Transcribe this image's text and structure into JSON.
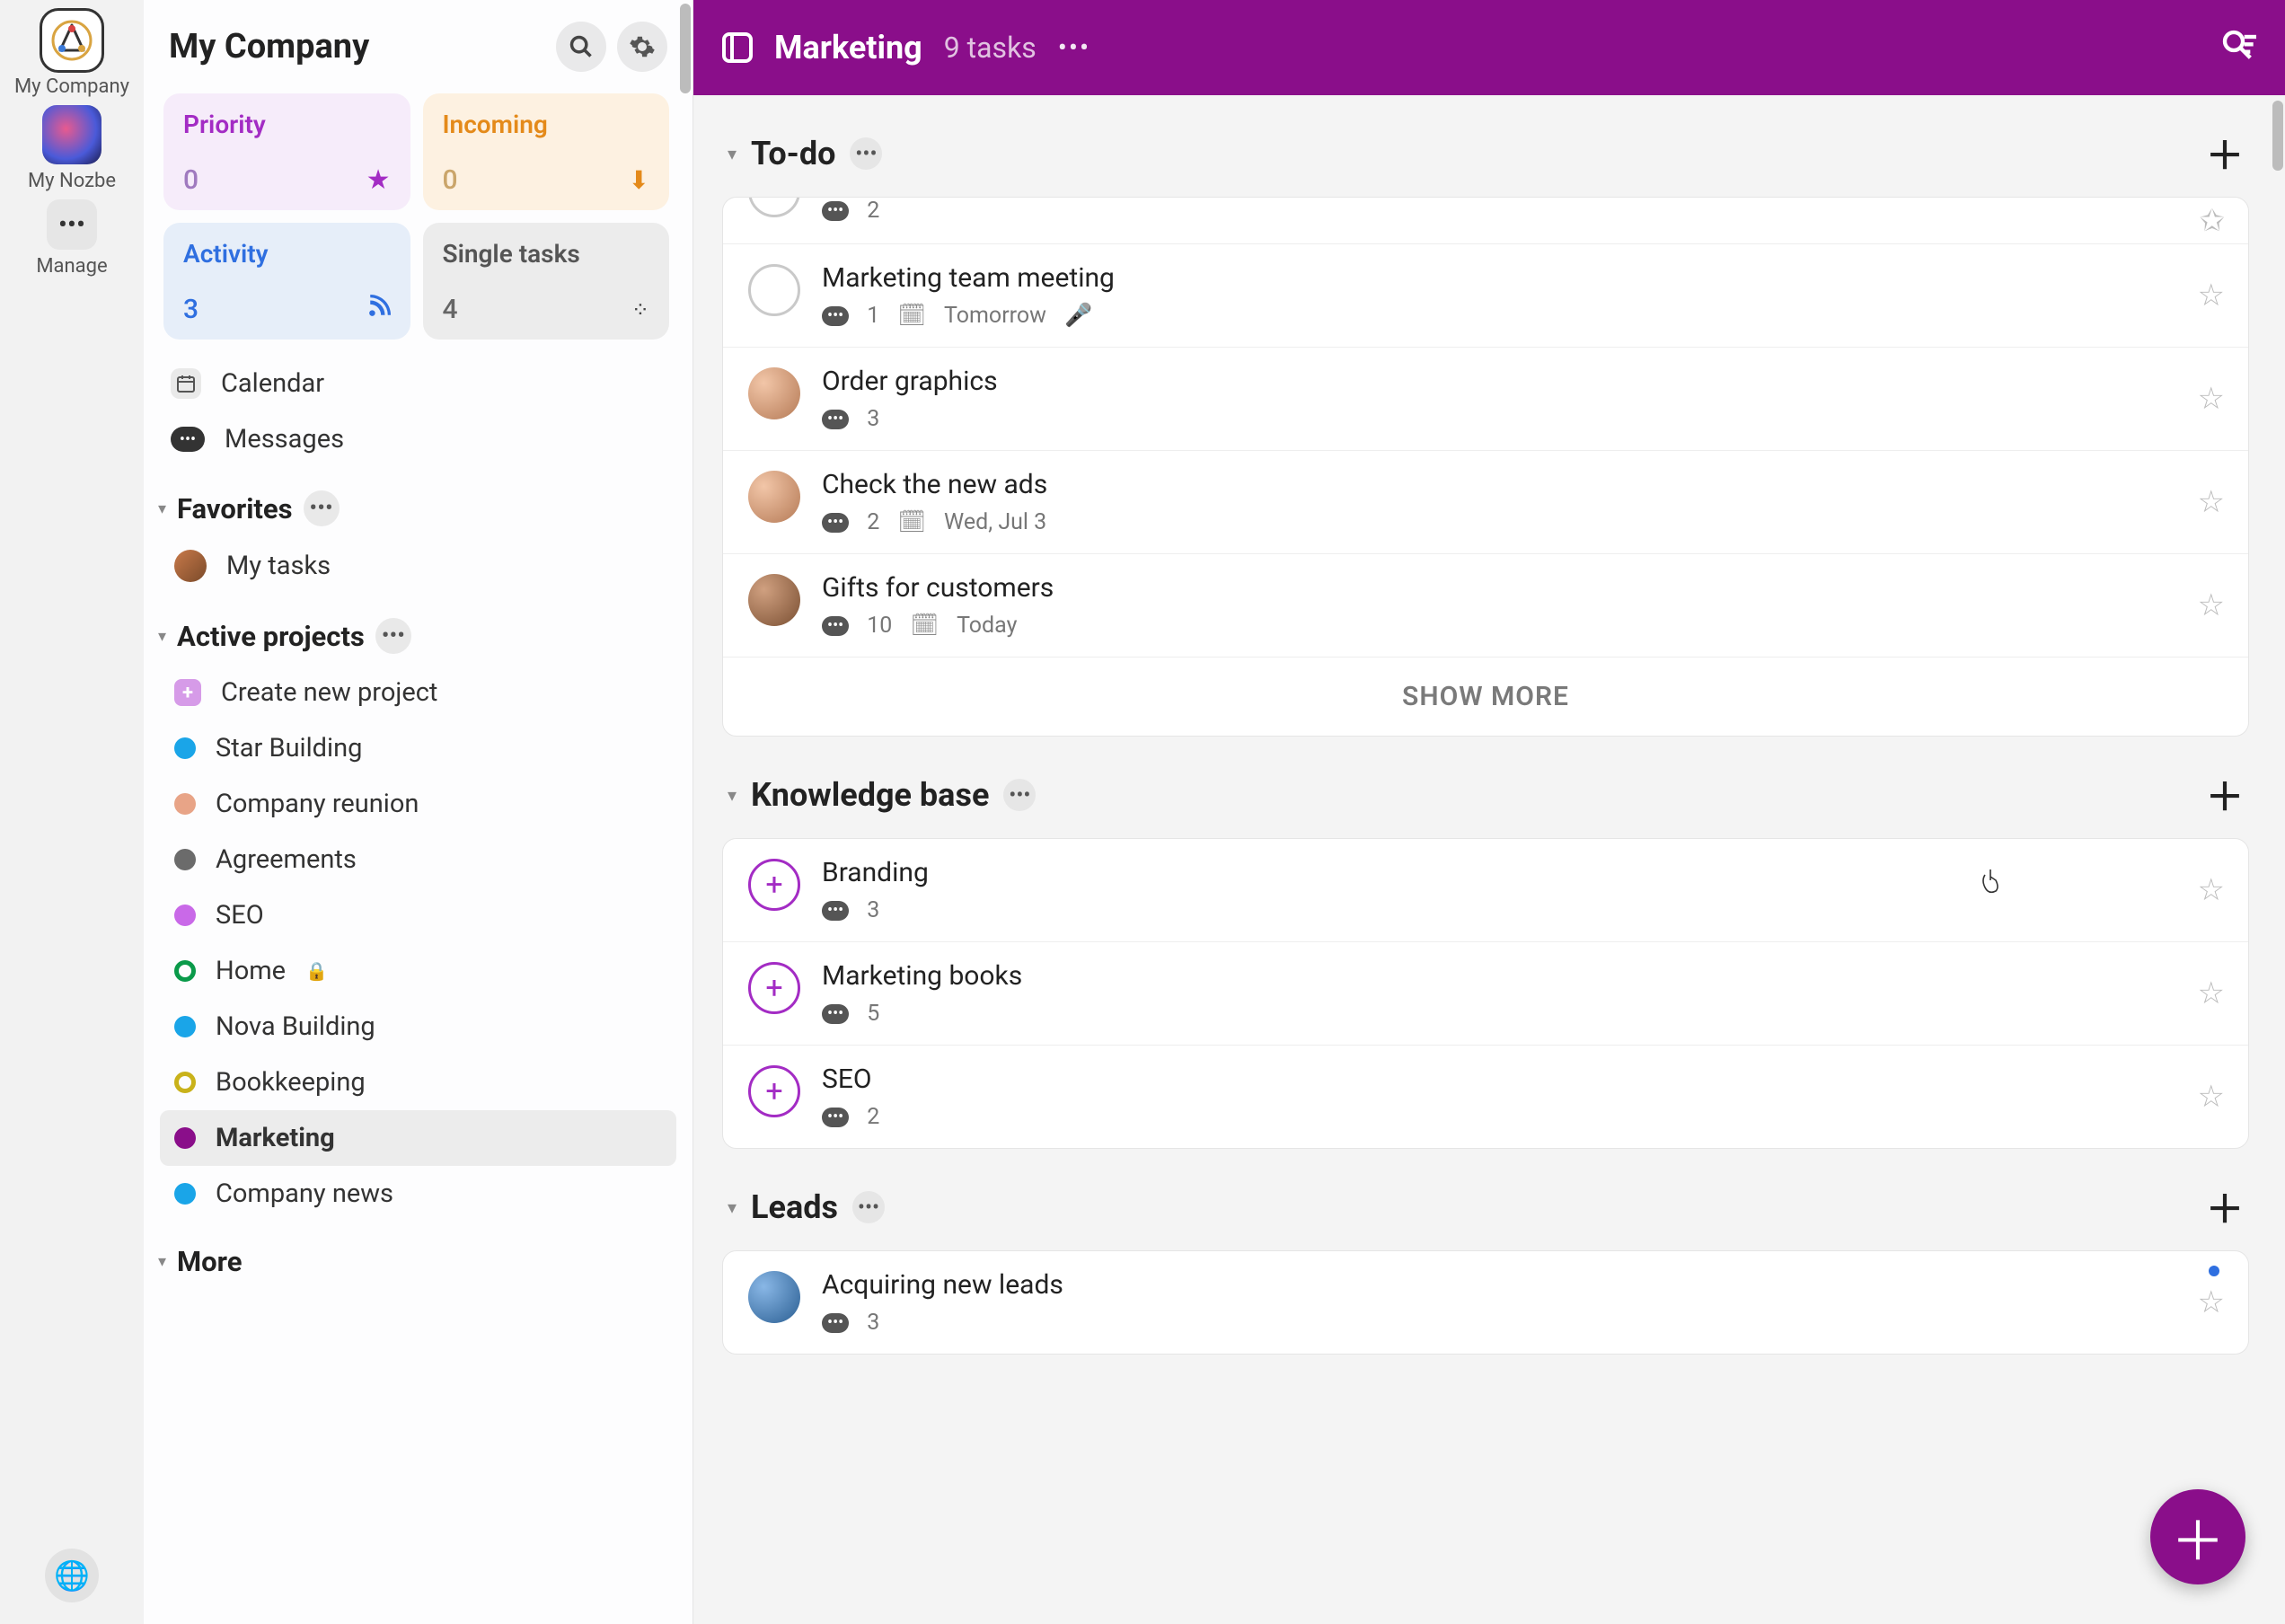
{
  "rail": {
    "items": [
      {
        "label": "My Company"
      },
      {
        "label": "My Nozbe"
      },
      {
        "label": "Manage"
      }
    ],
    "globe": "🌐"
  },
  "sidebar": {
    "title": "My Company",
    "tiles": {
      "priority": {
        "title": "Priority",
        "count": "0"
      },
      "incoming": {
        "title": "Incoming",
        "count": "0"
      },
      "activity": {
        "title": "Activity",
        "count": "3"
      },
      "single": {
        "title": "Single tasks",
        "count": "4"
      }
    },
    "nav": {
      "calendar": "Calendar",
      "messages": "Messages"
    },
    "favorites": {
      "title": "Favorites",
      "items": [
        {
          "label": "My tasks"
        }
      ]
    },
    "active": {
      "title": "Active projects",
      "create": "Create new project",
      "projects": [
        {
          "label": "Star Building",
          "color": "#1aa5e8"
        },
        {
          "label": "Company reunion",
          "color": "#e8a487"
        },
        {
          "label": "Agreements",
          "color": "#6b6b6b"
        },
        {
          "label": "SEO",
          "color": "#c969e8"
        },
        {
          "label": "Home",
          "color": "#0a9a4a",
          "ring": true,
          "locked": true
        },
        {
          "label": "Nova Building",
          "color": "#1aa5e8"
        },
        {
          "label": "Bookkeeping",
          "color": "#c9b21a",
          "ring": true
        },
        {
          "label": "Marketing",
          "color": "#8a0e8a",
          "active": true
        },
        {
          "label": "Company news",
          "color": "#1aa5e8"
        }
      ]
    },
    "more": "More"
  },
  "header": {
    "title": "Marketing",
    "count": "9 tasks"
  },
  "sections": {
    "todo": {
      "title": "To-do",
      "showmore": "SHOW MORE",
      "tasks": [
        {
          "title": "",
          "comments": "2",
          "partial": true
        },
        {
          "title": "Marketing team meeting",
          "comments": "1",
          "date": "Tomorrow",
          "mic": true
        },
        {
          "title": "Order graphics",
          "comments": "3",
          "avatar": "av1"
        },
        {
          "title": "Check the new ads",
          "comments": "2",
          "date": "Wed, Jul 3",
          "avatar": "av2"
        },
        {
          "title": "Gifts for customers",
          "comments": "10",
          "date": "Today",
          "avatar": "av3"
        }
      ]
    },
    "kb": {
      "title": "Knowledge base",
      "tasks": [
        {
          "title": "Branding",
          "comments": "3"
        },
        {
          "title": "Marketing books",
          "comments": "5"
        },
        {
          "title": "SEO",
          "comments": "2"
        }
      ]
    },
    "leads": {
      "title": "Leads",
      "tasks": [
        {
          "title": "Acquiring new leads",
          "comments": "3",
          "avatar": "av4",
          "bluedot": true
        }
      ]
    }
  }
}
